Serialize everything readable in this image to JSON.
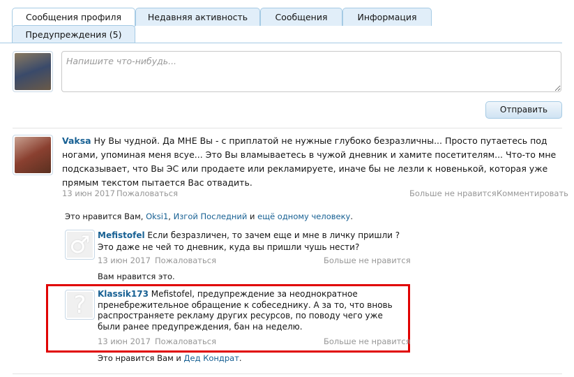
{
  "tabs": [
    "Сообщения профиля",
    "Недавняя активность",
    "Сообщения",
    "Информация",
    "Предупреждения (5)"
  ],
  "composer": {
    "placeholder": "Напишите что-нибудь...",
    "submit": "Отправить"
  },
  "post": {
    "author": "Vaksa",
    "text": "Ну Вы чудной. Да МНЕ Вы - с приплатой не нужные глубоко безразличны... Просто путаетесь под ногами, упоминая меня всуе... Это Вы вламываетесь в чужой дневник и хамите посетителям... Что-то мне подсказывает, что Вы ЭС или продаете или рекламируете, иначе бы не лезли к новенькой, которая уже прямым текстом пытается Вас отвадить.",
    "date": "13 июн 2017",
    "report": "Пожаловаться",
    "unlike": "Больше не нравится",
    "comment": "Комментировать"
  },
  "likes": {
    "prefix": "Это нравится Вам, ",
    "user1": "Oksi1",
    "sep": ", ",
    "user2": "Изгой Последний",
    "mid": " и ",
    "others": "ещё одному человеку",
    "end": "."
  },
  "comments": [
    {
      "author": "Mefistofel",
      "text": " Если безразличен, то зачем еще и мне в личку пришли ? Это даже не чей то дневник, куда вы пришли чушь нести?",
      "date": "13 июн 2017",
      "report": "Пожаловаться",
      "unlike": "Больше не нравится",
      "likes": "Вам нравится это.",
      "icon": "♂"
    },
    {
      "author": "Klassik173",
      "text": " Mefistofel, предупреждение за неоднократное пренебрежительное обращение к собеседнику. А за то, что вновь распространяете рекламу других ресурсов, по поводу чего уже были ранее предупреждения, бан на неделю.",
      "date": "13 июн 2017",
      "report": "Пожаловаться",
      "unlike": "Больше не нравится",
      "likes_prefix": "Это нравится Вам и ",
      "likes_user": "Дед Кондрат",
      "likes_end": ".",
      "icon": "?"
    }
  ]
}
